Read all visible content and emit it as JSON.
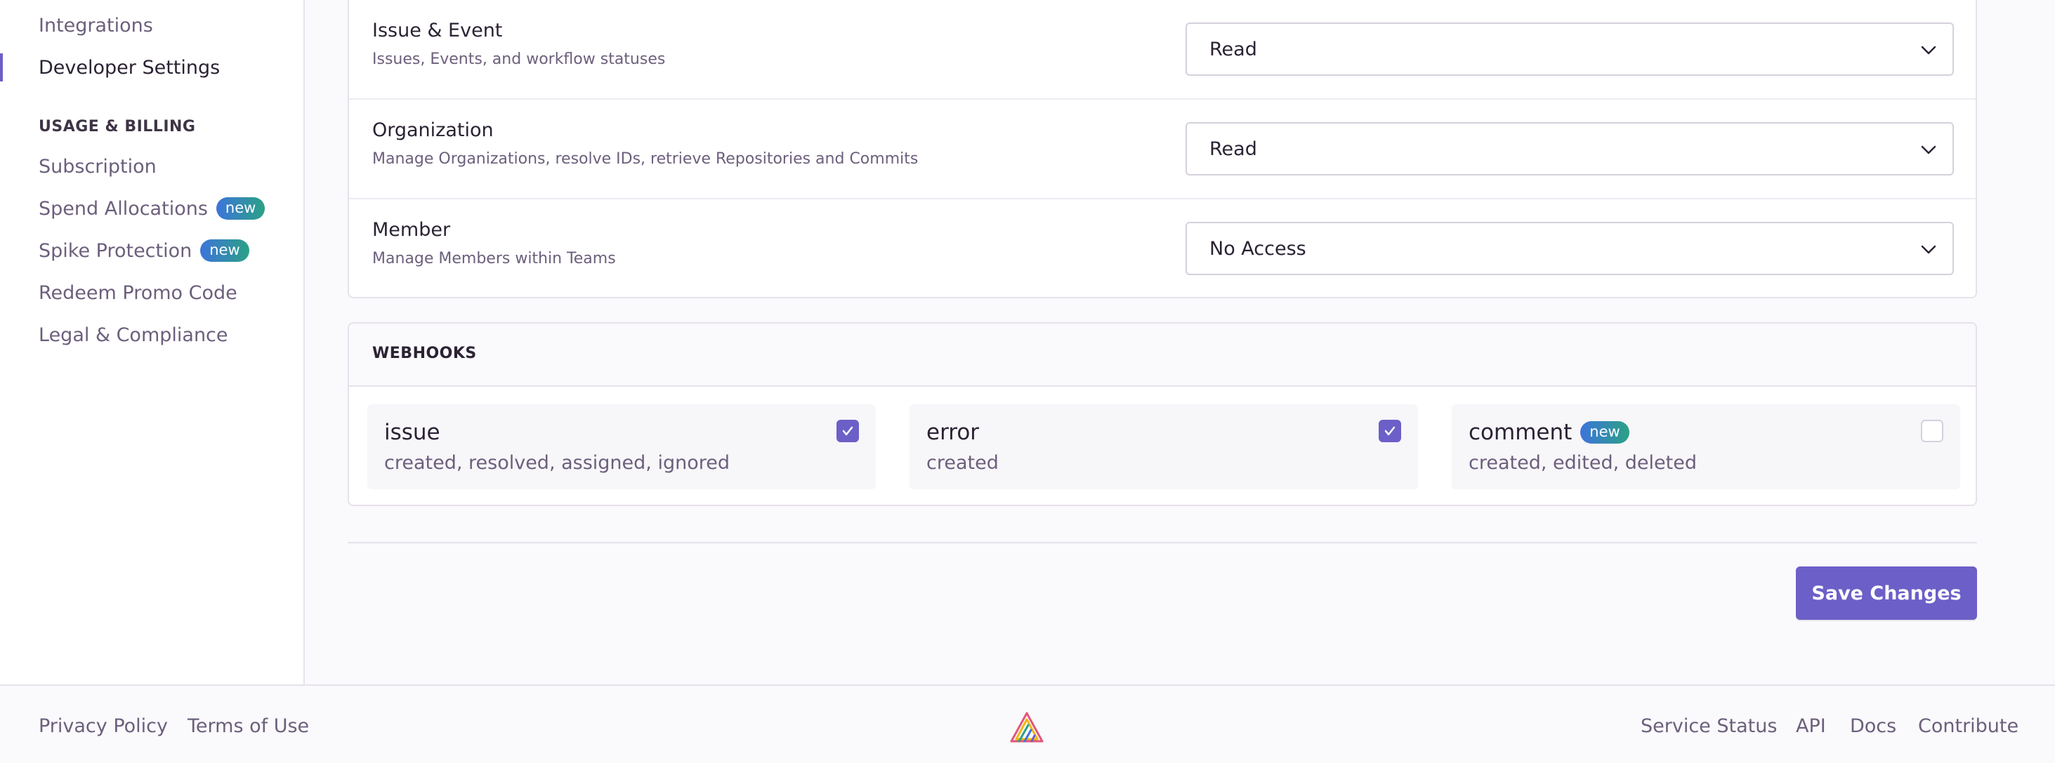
{
  "sidebar": {
    "items_top": [
      {
        "label": "Integrations"
      },
      {
        "label": "Developer Settings"
      }
    ],
    "section_billing": "USAGE & BILLING",
    "items_billing": [
      {
        "label": "Subscription"
      },
      {
        "label": "Spend Allocations",
        "badge": "new"
      },
      {
        "label": "Spike Protection",
        "badge": "new"
      },
      {
        "label": "Redeem Promo Code"
      },
      {
        "label": "Legal & Compliance"
      }
    ]
  },
  "permissions": [
    {
      "title": "Issue & Event",
      "description": "Issues, Events, and workflow statuses",
      "value": "Read"
    },
    {
      "title": "Organization",
      "description": "Manage Organizations, resolve IDs, retrieve Repositories and Commits",
      "value": "Read"
    },
    {
      "title": "Member",
      "description": "Manage Members within Teams",
      "value": "No Access"
    }
  ],
  "webhooks": {
    "header": "WEBHOOKS",
    "items": [
      {
        "name": "issue",
        "events": "created, resolved, assigned, ignored",
        "checked": true
      },
      {
        "name": "error",
        "events": "created",
        "checked": true
      },
      {
        "name": "comment",
        "events": "created, edited, deleted",
        "checked": false,
        "badge": "new"
      }
    ]
  },
  "save_label": "Save Changes",
  "footer": {
    "left_links": [
      "Privacy Policy",
      "Terms of Use"
    ],
    "right_links": [
      "Service Status",
      "API",
      "Docs",
      "Contribute"
    ]
  },
  "colors": {
    "accent": "#6c5fc7",
    "badge_gradient_start": "#3d74db",
    "badge_gradient_end": "#2ba185"
  }
}
